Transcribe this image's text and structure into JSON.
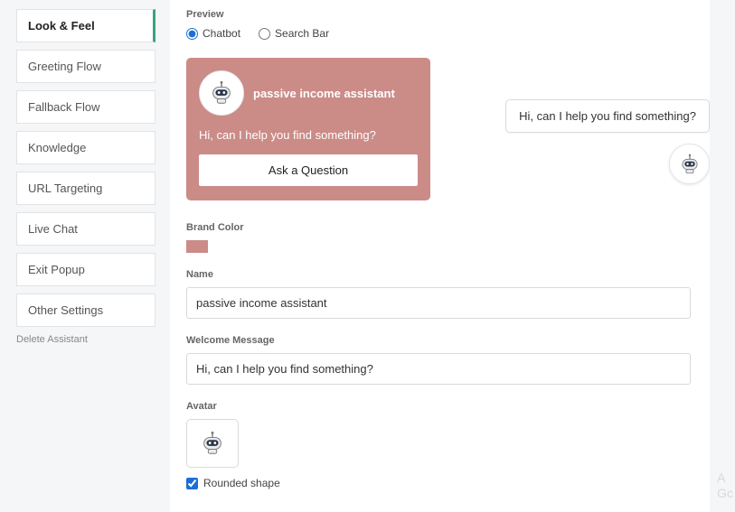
{
  "sidebar": {
    "items": [
      {
        "label": "Look & Feel"
      },
      {
        "label": "Greeting Flow"
      },
      {
        "label": "Fallback Flow"
      },
      {
        "label": "Knowledge"
      },
      {
        "label": "URL Targeting"
      },
      {
        "label": "Live Chat"
      },
      {
        "label": "Exit Popup"
      },
      {
        "label": "Other Settings"
      }
    ],
    "delete_label": "Delete Assistant"
  },
  "preview": {
    "label": "Preview",
    "radio_chatbot": "Chatbot",
    "radio_searchbar": "Search Bar",
    "card_title": "passive income assistant",
    "card_message": "Hi, can I help you find something?",
    "ask_button": "Ask a Question",
    "bubble_text": "Hi, can I help you find something?"
  },
  "brand_color": {
    "label": "Brand Color",
    "value": "#cb8b87"
  },
  "name": {
    "label": "Name",
    "value": "passive income assistant"
  },
  "welcome": {
    "label": "Welcome Message",
    "value": "Hi, can I help you find something?"
  },
  "avatar": {
    "label": "Avatar",
    "rounded_label": "Rounded shape"
  },
  "edge": {
    "line1": "A",
    "line2": "Gc"
  }
}
